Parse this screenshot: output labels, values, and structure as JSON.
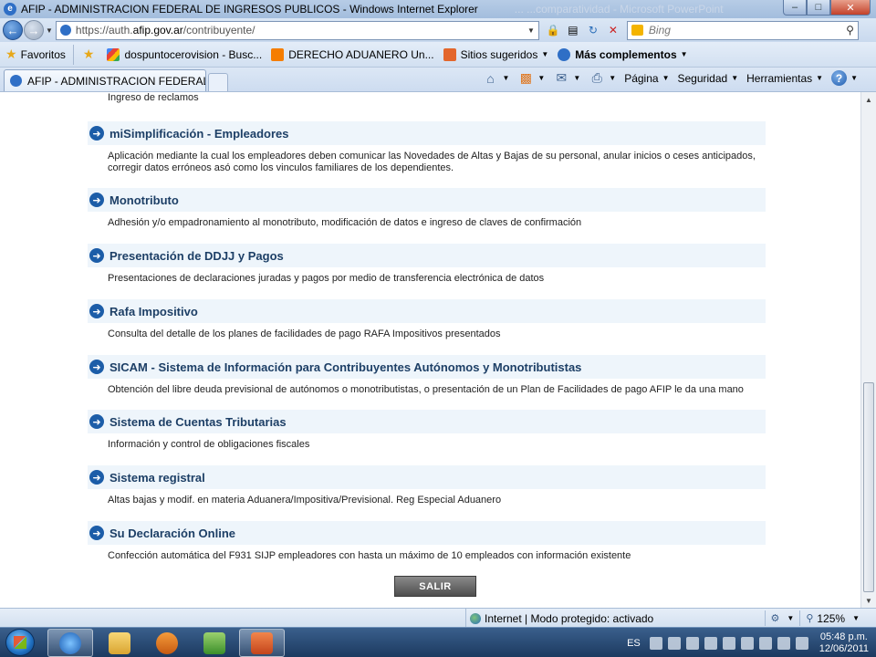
{
  "window": {
    "title": "AFIP - ADMINISTRACION FEDERAL DE INGRESOS PUBLICOS - Windows Internet Explorer",
    "ghost_title": "...   ...comparatividad  -  Microsoft PowerPoint",
    "minimize": "–",
    "maximize": "□",
    "close": "✕"
  },
  "address_bar": {
    "url_prefix": "https://auth.",
    "url_domain": "afip.gov.ar",
    "url_path": "/contribuyente/",
    "search_placeholder": "Bing"
  },
  "favorites_bar": {
    "favorites_label": "Favoritos",
    "items": [
      {
        "label": "dospuntocerovision - Busc...",
        "icon": "google-icon"
      },
      {
        "label": "DERECHO ADUANERO Un...",
        "icon": "blogger-icon"
      },
      {
        "label": "Sitios sugeridos",
        "icon": "suggested-sites-icon",
        "dropdown": true
      },
      {
        "label": "Más complementos",
        "icon": "ie-icon",
        "dropdown": true,
        "bold": true
      }
    ]
  },
  "tab": {
    "label": "AFIP - ADMINISTRACION FEDERAL D..."
  },
  "command_bar": {
    "page": "Página",
    "security": "Seguridad",
    "tools": "Herramientas",
    "help": "?"
  },
  "content": {
    "previous_item_desc": "Ingreso de reclamos",
    "services": [
      {
        "name": "miSimplificación - Empleadores",
        "desc": "Aplicación mediante la cual los empleadores deben comunicar las Novedades de Altas y Bajas de su personal, anular inicios o ceses anticipados, corregir datos erróneos asó como los vinculos familiares de los dependientes."
      },
      {
        "name": "Monotributo",
        "desc": "Adhesión y/o empadronamiento al monotributo, modificación de datos e ingreso de claves de confirmación"
      },
      {
        "name": "Presentación de DDJJ y Pagos",
        "desc": "Presentaciones de declaraciones juradas y pagos por medio de transferencia electrónica de datos"
      },
      {
        "name": "Rafa Impositivo",
        "desc": "Consulta del detalle de los planes de facilidades de pago RAFA Impositivos presentados"
      },
      {
        "name": "SICAM - Sistema de Información para Contribuyentes Autónomos y Monotributistas",
        "desc": "Obtención del libre deuda previsional de autónomos o monotributistas, o presentación de un Plan de Facilidades de pago AFIP le da una mano"
      },
      {
        "name": "Sistema de Cuentas Tributarias",
        "desc": "Información y control de obligaciones fiscales"
      },
      {
        "name": "Sistema registral",
        "desc": "Altas bajas y modif. en materia Aduanera/Impositiva/Previsional. Reg Especial Aduanero"
      },
      {
        "name": "Su Declaración Online",
        "desc": "Confección automática del F931 SIJP empleadores con hasta un máximo de 10 empleados con información existente"
      }
    ],
    "exit_button": "SALIR"
  },
  "status_bar": {
    "zone": "Internet | Modo protegido: activado",
    "zoom": "125%"
  },
  "taskbar": {
    "language": "ES",
    "time": "05:48 p.m.",
    "date": "12/06/2011"
  }
}
